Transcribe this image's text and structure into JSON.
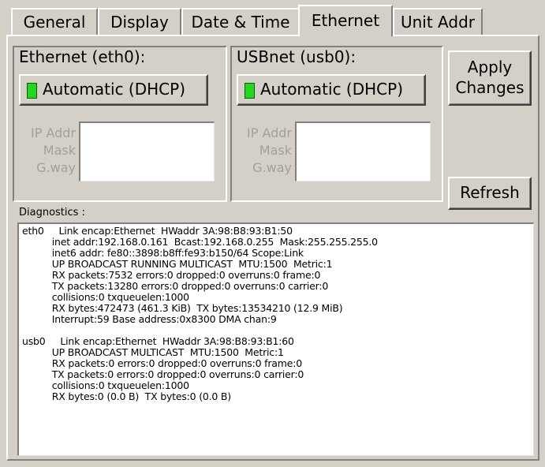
{
  "tabs": [
    {
      "label": "General",
      "active": false
    },
    {
      "label": "Display",
      "active": false
    },
    {
      "label": "Date & Time",
      "active": false
    },
    {
      "label": "Ethernet",
      "active": true
    },
    {
      "label": "Unit Addr",
      "active": false
    }
  ],
  "eth0": {
    "title": "Ethernet (eth0):",
    "mode_button": "Automatic (DHCP)",
    "led_color": "#22d81c",
    "labels": [
      "IP Addr",
      "Mask",
      "G.way"
    ],
    "ip_addr": "",
    "mask": "",
    "gateway": ""
  },
  "usb0": {
    "title": "USBnet (usb0):",
    "mode_button": "Automatic (DHCP)",
    "led_color": "#22d81c",
    "labels": [
      "IP Addr",
      "Mask",
      "G.way"
    ],
    "ip_addr": "",
    "mask": "",
    "gateway": ""
  },
  "buttons": {
    "apply_line1": "Apply",
    "apply_line2": "Changes",
    "refresh": "Refresh"
  },
  "diagnostics": {
    "label": "Diagnostics :",
    "lines": [
      "eth0     Link encap:Ethernet  HWaddr 3A:98:B8:93:B1:50",
      "          inet addr:192.168.0.161  Bcast:192.168.0.255  Mask:255.255.255.0",
      "          inet6 addr: fe80::3898:b8ff:fe93:b150/64 Scope:Link",
      "          UP BROADCAST RUNNING MULTICAST  MTU:1500  Metric:1",
      "          RX packets:7532 errors:0 dropped:0 overruns:0 frame:0",
      "          TX packets:13280 errors:0 dropped:0 overruns:0 carrier:0",
      "          collisions:0 txqueuelen:1000",
      "          RX bytes:472473 (461.3 KiB)  TX bytes:13534210 (12.9 MiB)",
      "          Interrupt:59 Base address:0x8300 DMA chan:9",
      "",
      "usb0     Link encap:Ethernet  HWaddr 3A:98:B8:93:B1:60",
      "          UP BROADCAST MULTICAST  MTU:1500  Metric:1",
      "          RX packets:0 errors:0 dropped:0 overruns:0 frame:0",
      "          TX packets:0 errors:0 dropped:0 overruns:0 carrier:0",
      "          collisions:0 txqueuelen:1000",
      "          RX bytes:0 (0.0 B)  TX bytes:0 (0.0 B)"
    ]
  }
}
